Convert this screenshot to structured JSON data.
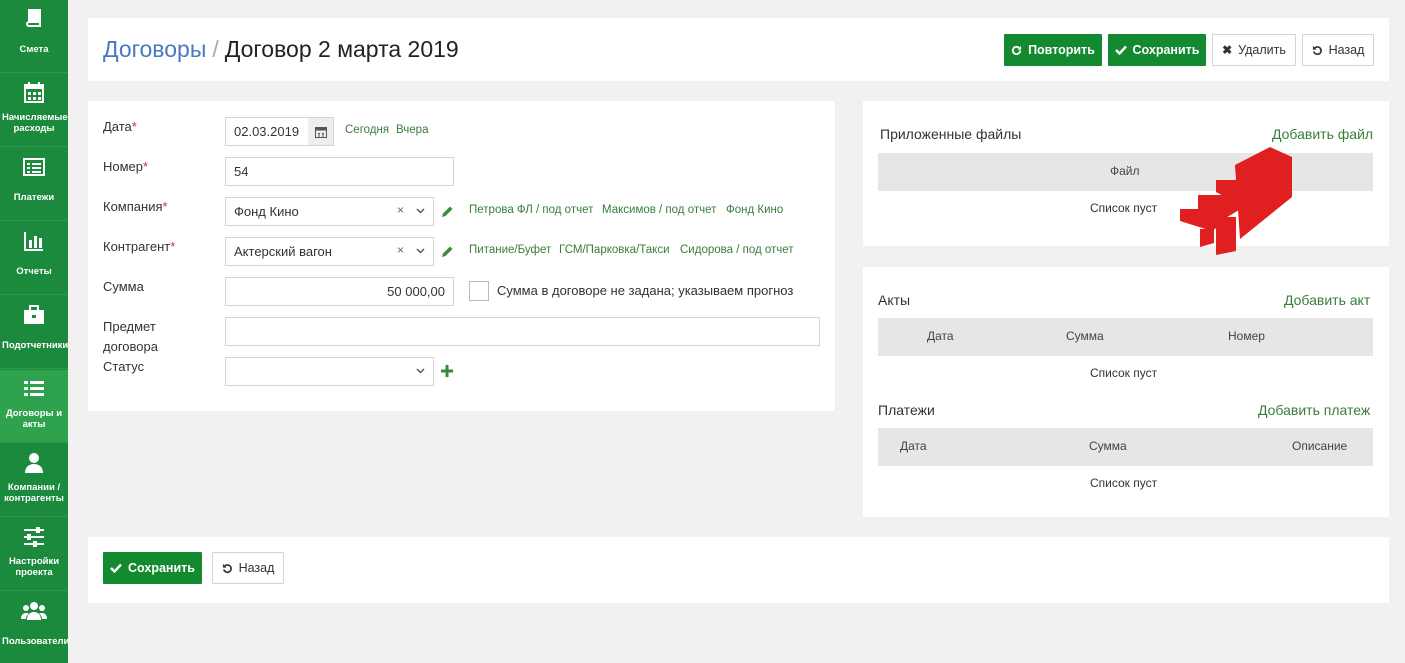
{
  "sidebar": {
    "items": [
      {
        "label": "Смета",
        "icon": "book-icon"
      },
      {
        "label": "Начисляемые расходы",
        "icon": "calendar-icon"
      },
      {
        "label": "Платежи",
        "icon": "list-card-icon"
      },
      {
        "label": "Отчеты",
        "icon": "bar-chart-icon"
      },
      {
        "label": "Подотчетники",
        "icon": "briefcase-icon"
      },
      {
        "label": "Договоры и акты",
        "icon": "list-icon"
      },
      {
        "label": "Компании / контрагенты",
        "icon": "user-icon"
      },
      {
        "label": "Настройки проекта",
        "icon": "sliders-icon"
      },
      {
        "label": "Пользователи",
        "icon": "users-icon"
      }
    ]
  },
  "header": {
    "breadcrumb_link": "Договоры",
    "breadcrumb_sep": "/",
    "title": "Договор 2 марта 2019",
    "repeat_label": "Повторить",
    "save_label": "Сохранить",
    "delete_label": "Удалить",
    "back_label": "Назад"
  },
  "form": {
    "date": {
      "label": "Дата",
      "value": "02.03.2019",
      "today": "Сегодня",
      "yesterday": "Вчера"
    },
    "number": {
      "label": "Номер",
      "value": "54"
    },
    "company": {
      "label": "Компания",
      "value": "Фонд Кино",
      "quick": [
        "Петрова ФЛ / под отчет",
        "Максимов / под отчет",
        "Фонд Кино"
      ]
    },
    "counterparty": {
      "label": "Контрагент",
      "value": "Актерский вагон",
      "quick": [
        "Питание/Буфет",
        "ГСМ/Парковка/Такси",
        "Сидорова / под отчет"
      ]
    },
    "sum": {
      "label": "Сумма",
      "value": "50 000,00",
      "checkbox_label": "Сумма в договоре не задана; указываем прогноз"
    },
    "subject": {
      "label_line1": "Предмет",
      "label_line2": "договора",
      "value": ""
    },
    "status": {
      "label": "Статус",
      "value": ""
    },
    "required_mark": "*",
    "clear_glyph": "×"
  },
  "files": {
    "title": "Приложенные файлы",
    "add_label": "Добавить файл",
    "column": "Файл",
    "empty": "Список пуст"
  },
  "acts": {
    "title": "Акты",
    "add_label": "Добавить акт",
    "columns": [
      "Дата",
      "Сумма",
      "Номер"
    ],
    "empty": "Список пуст"
  },
  "payments": {
    "title": "Платежи",
    "add_label": "Добавить платеж",
    "columns": [
      "Дата",
      "Сумма",
      "Описание"
    ],
    "empty": "Список пуст"
  },
  "footer": {
    "save_label": "Сохранить",
    "back_label": "Назад"
  },
  "colors": {
    "sidebar": "#1c8a3c",
    "primary_button": "#138a2f",
    "link": "#3a7d3a",
    "breadcrumb_link": "#4a78c2",
    "watermark": "#e02020"
  }
}
